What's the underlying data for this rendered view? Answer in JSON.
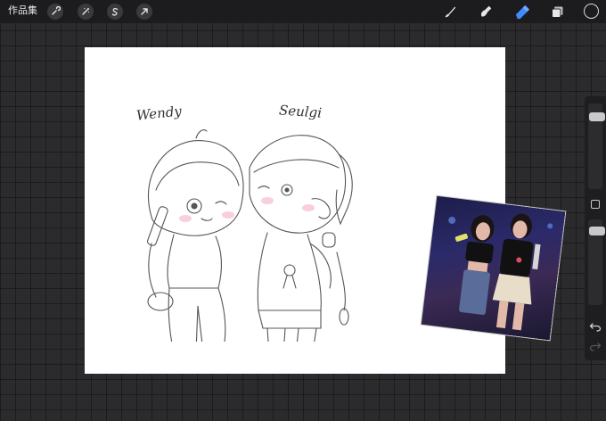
{
  "topbar": {
    "gallery_label": "作品集",
    "left_tools": [
      {
        "icon": "wrench-icon",
        "name": "actions"
      },
      {
        "icon": "magic-wand-icon",
        "name": "adjustments"
      },
      {
        "icon": "selection-s-icon",
        "name": "selection"
      },
      {
        "icon": "cursor-arrow-icon",
        "name": "transform"
      }
    ],
    "right_tools": [
      {
        "icon": "brush-icon",
        "name": "paint"
      },
      {
        "icon": "smudge-icon",
        "name": "smudge"
      },
      {
        "icon": "eraser-icon",
        "name": "erase",
        "active": true
      },
      {
        "icon": "layers-icon",
        "name": "layers"
      }
    ],
    "active_color": "#1c1c1e",
    "active_tool_color": "#3d8cff"
  },
  "canvas": {
    "labels": {
      "left_name": "Wendy",
      "right_name": "Seulgi"
    },
    "background": "#ffffff"
  },
  "sidebar": {
    "brush_size_level": 0.12,
    "opacity_level": 0.2,
    "icons": [
      "modify-icon",
      "undo-icon",
      "redo-icon"
    ]
  }
}
